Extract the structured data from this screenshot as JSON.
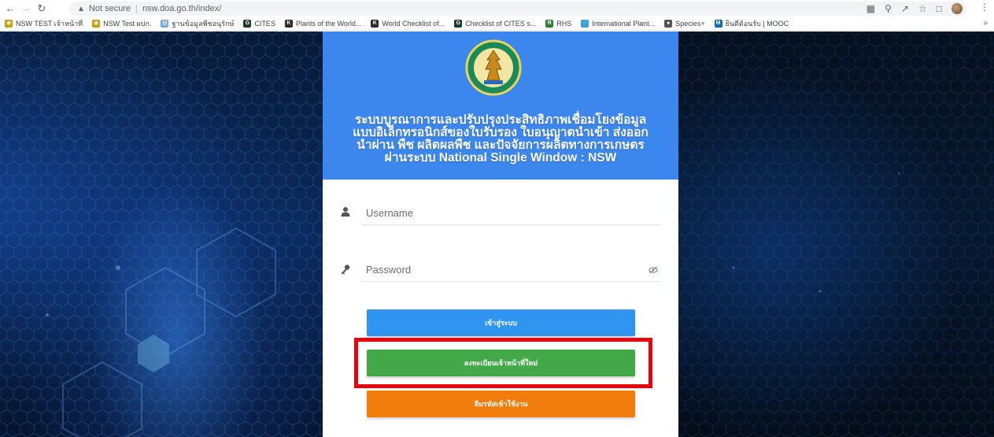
{
  "browser": {
    "not_secure": "Not secure",
    "url": "nsw.doa.go.th/index/",
    "bookmarks": [
      {
        "label": "NSW TEST เจ้าหน้าที่",
        "icon": "globe-icon",
        "color": "#c4a000"
      },
      {
        "label": "NSW Test ผปก.",
        "icon": "globe-icon",
        "color": "#c4a000"
      },
      {
        "label": "ฐานข้อมูลพืชอนุรักษ์",
        "icon": "doc-icon",
        "color": "#7aa7d8"
      },
      {
        "label": "CITES",
        "icon": "cites-icon",
        "color": "#1b3b2f"
      },
      {
        "label": "Plants of the World...",
        "icon": "k-icon",
        "color": "#2b2b2b"
      },
      {
        "label": "World Checklist of...",
        "icon": "k-icon",
        "color": "#2b2b2b"
      },
      {
        "label": "Checklist of CITES s...",
        "icon": "cites-icon",
        "color": "#1b3b2f"
      },
      {
        "label": "RHS",
        "icon": "rhs-icon",
        "color": "#2e7d32"
      },
      {
        "label": "International Plant...",
        "icon": "ipni-icon",
        "color": "#3aa0d8"
      },
      {
        "label": "Species+",
        "icon": "species-icon",
        "color": "#555555"
      },
      {
        "label": "ยินดีต้อนรับ | MOOC",
        "icon": "mooc-icon",
        "color": "#1565c0"
      }
    ]
  },
  "login": {
    "title_lines": [
      "ระบบบูรณาการและปรับปรุงประสิทธิภาพเชื่อมโยงข้อมูล",
      "แบบอิเล็กทรอนิกส์ของใบรับรอง ใบอนุญาตนำเข้า ส่งออก",
      "นำผ่าน พืช ผลิตผลพืช และปัจจัยการผลิตทางการเกษตร",
      "ผ่านระบบ National Single Window : NSW"
    ],
    "username_placeholder": "Username",
    "password_placeholder": "Password",
    "login_button": "เข้าสู่ระบบ",
    "register_button": "ลงทะเบียนเจ้าหน้าที่ใหม่",
    "forgot_button": "ลืมรหัสเข้าใช้งาน"
  },
  "colors": {
    "header_blue": "#3c87ee",
    "login_blue": "#2f95f1",
    "register_green": "#43a847",
    "forgot_orange": "#f17d0b",
    "highlight_red": "#e8000d"
  }
}
